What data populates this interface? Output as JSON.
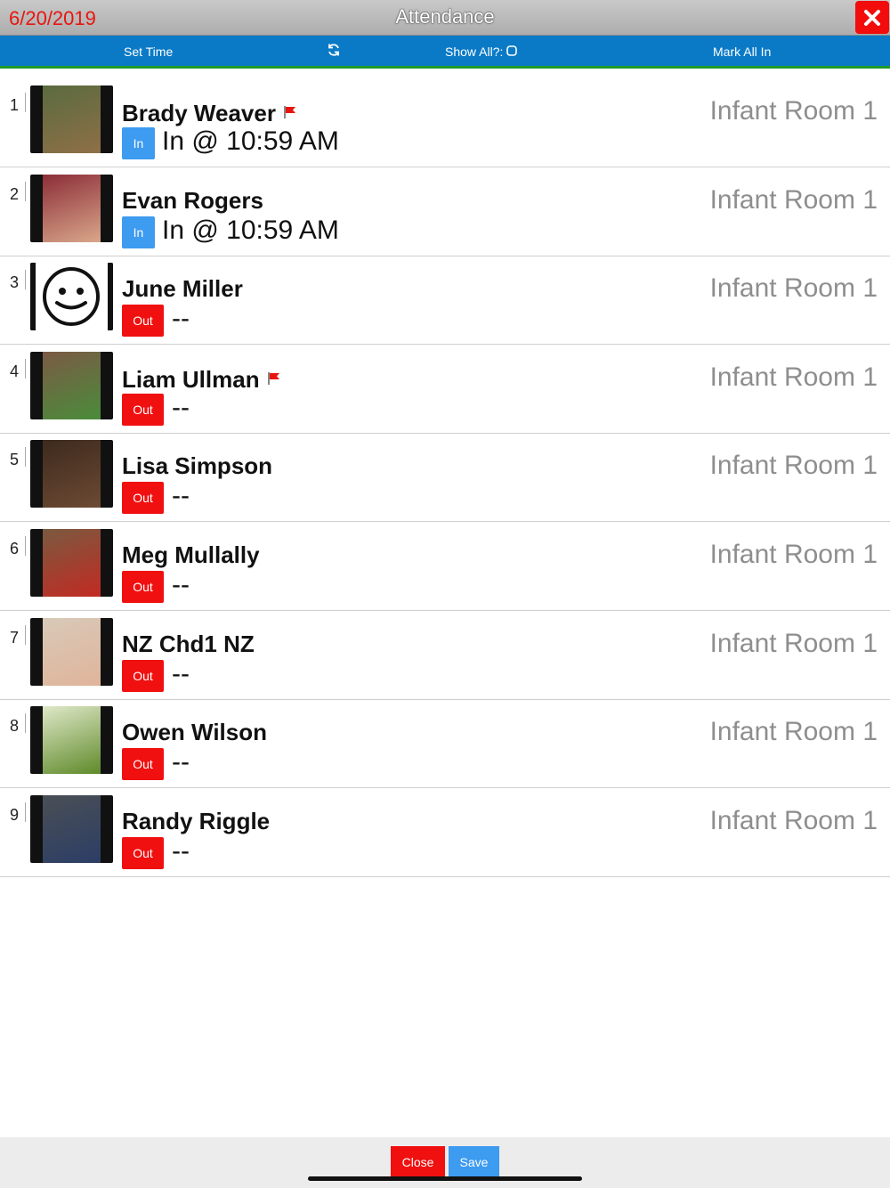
{
  "header": {
    "date": "6/20/2019",
    "title": "Attendance"
  },
  "toolbar": {
    "set_time": "Set Time",
    "show_all": "Show All?:",
    "mark_all_in": "Mark All In"
  },
  "children": [
    {
      "num": "1",
      "name": "Brady Weaver",
      "flag": true,
      "room": "Infant Room 1",
      "status_badge": "In",
      "status_text": "In @ 10:59 AM",
      "photo_colors": [
        "#5a6b3f",
        "#8f6f47"
      ]
    },
    {
      "num": "2",
      "name": "Evan Rogers",
      "flag": false,
      "room": "Infant Room 1",
      "status_badge": "In",
      "status_text": "In @ 10:59 AM",
      "photo_colors": [
        "#8c2d38",
        "#d9a78a"
      ]
    },
    {
      "num": "3",
      "name": "June Miller",
      "flag": false,
      "room": "Infant Room 1",
      "status_badge": "Out",
      "status_text": "--",
      "photo_colors": [
        "#ffffff",
        "#ffffff"
      ]
    },
    {
      "num": "4",
      "name": "Liam Ullman",
      "flag": true,
      "room": "Infant Room 1",
      "status_badge": "Out",
      "status_text": "--",
      "photo_colors": [
        "#7b5a45",
        "#4a8c3a"
      ]
    },
    {
      "num": "5",
      "name": "Lisa Simpson",
      "flag": false,
      "room": "Infant Room 1",
      "status_badge": "Out",
      "status_text": "--",
      "photo_colors": [
        "#3d2a1e",
        "#6d4a33"
      ]
    },
    {
      "num": "6",
      "name": "Meg Mullally",
      "flag": false,
      "room": "Infant Room 1",
      "status_badge": "Out",
      "status_text": "--",
      "photo_colors": [
        "#7a5a40",
        "#c22a22"
      ]
    },
    {
      "num": "7",
      "name": "NZ Chd1 NZ",
      "flag": false,
      "room": "Infant Room 1",
      "status_badge": "Out",
      "status_text": "--",
      "photo_colors": [
        "#d8c9b8",
        "#e0b49a"
      ]
    },
    {
      "num": "8",
      "name": "Owen Wilson",
      "flag": false,
      "room": "Infant Room 1",
      "status_badge": "Out",
      "status_text": "--",
      "photo_colors": [
        "#dfe8c8",
        "#5f8a2a"
      ]
    },
    {
      "num": "9",
      "name": "Randy Riggle",
      "flag": false,
      "room": "Infant Room 1",
      "status_badge": "Out",
      "status_text": "--",
      "photo_colors": [
        "#4a4f55",
        "#2c3e66"
      ]
    }
  ],
  "footer": {
    "close_label": "Close",
    "save_label": "Save"
  },
  "colors": {
    "in_badge": "#3d9bf0",
    "out_badge": "#f01010",
    "toolbar": "#0a7ac6",
    "toolbar_border": "#1e9a2a",
    "date": "#e8150f"
  }
}
